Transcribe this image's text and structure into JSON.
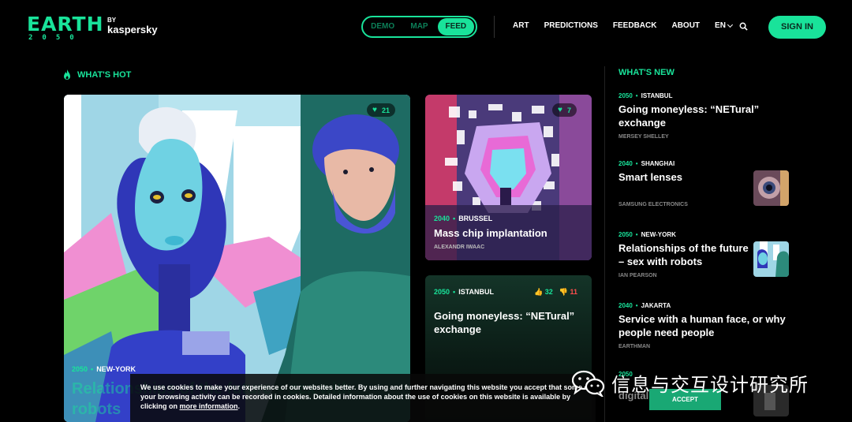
{
  "brand": {
    "name": "EARTH",
    "year": "2050",
    "by": "BY",
    "partner": "kaspersky"
  },
  "mode_switch": [
    "DEMO",
    "MAP",
    "FEED"
  ],
  "mode_active": "FEED",
  "nav": {
    "items": [
      "ART",
      "PREDICTIONS",
      "FEEDBACK",
      "ABOUT"
    ],
    "lang": "EN"
  },
  "signin_label": "SIGN IN",
  "hot": {
    "heading": "WHAT'S HOT",
    "big": {
      "likes": "21",
      "year": "2050",
      "city": "NEW-YORK",
      "title": "Relationships of the future – sex with robots"
    },
    "top": {
      "likes": "7",
      "year": "2040",
      "city": "BRUSSEL",
      "title": "Mass chip implantation",
      "author": "ALEXANDR IWAAC"
    },
    "dark": {
      "year": "2050",
      "city": "ISTANBUL",
      "title": "Going moneyless: “NETural” exchange",
      "up": "32",
      "down": "11"
    }
  },
  "news": {
    "heading": "WHAT'S NEW",
    "items": [
      {
        "year": "2050",
        "city": "ISTANBUL",
        "title": "Going moneyless: “NETural” exchange",
        "author": "MERSEY SHELLEY"
      },
      {
        "year": "2040",
        "city": "SHANGHAI",
        "title": "Smart lenses",
        "author": "SAMSUNG ELECTRONICS"
      },
      {
        "year": "2050",
        "city": "NEW-YORK",
        "title": "Relationships of the future – sex with robots",
        "author": "IAN PEARSON"
      },
      {
        "year": "2040",
        "city": "JAKARTA",
        "title": "Service with a human face, or why people need people",
        "author": "EARTHMAN"
      },
      {
        "year": "2050",
        "title": "digital"
      }
    ]
  },
  "cookie": {
    "text": "We use cookies to make your experience of our websites better. By using and further navigating this website you accept that some of your browsing activity can be recorded in cookies. Detailed information about the use of cookies on this website is available by clicking on",
    "link": "more information",
    "end": ".",
    "accept": "ACCEPT"
  },
  "watermark": "信息与交互设计研究所",
  "colors": {
    "accent": "#19e39a",
    "background": "#000000",
    "downvote": "#ff4d4d"
  }
}
